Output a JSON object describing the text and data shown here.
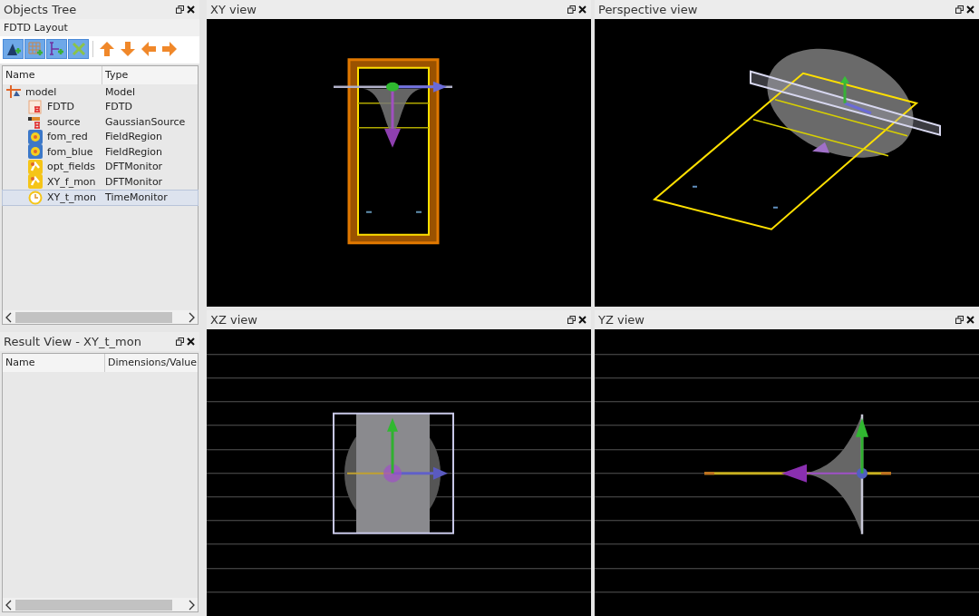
{
  "objects_tree": {
    "title": "Objects Tree",
    "layout_label": "FDTD Layout",
    "columns": [
      "Name",
      "Type"
    ],
    "rows": [
      {
        "name": "model",
        "type": "Model",
        "kind": "model",
        "selected": false,
        "children": [
          {
            "name": "FDTD",
            "type": "FDTD",
            "kind": "fdtd",
            "selected": false
          },
          {
            "name": "source",
            "type": "GaussianSource",
            "kind": "source",
            "selected": false
          },
          {
            "name": "fom_red",
            "type": "FieldRegion",
            "kind": "field_region",
            "selected": false
          },
          {
            "name": "fom_blue",
            "type": "FieldRegion",
            "kind": "field_region",
            "selected": false
          },
          {
            "name": "opt_fields",
            "type": "DFTMonitor",
            "kind": "dft_monitor",
            "selected": false
          },
          {
            "name": "XY_f_mon",
            "type": "DFTMonitor",
            "kind": "dft_monitor",
            "selected": false
          },
          {
            "name": "XY_t_mon",
            "type": "TimeMonitor",
            "kind": "time_monitor",
            "selected": true
          }
        ]
      }
    ]
  },
  "result_view": {
    "title": "Result View - XY_t_mon",
    "columns": [
      "Name",
      "Dimensions/Value"
    ]
  },
  "views": [
    {
      "title": "XY view",
      "kind": "xy"
    },
    {
      "title": "Perspective view",
      "kind": "perspective"
    },
    {
      "title": "XZ view",
      "kind": "xz"
    },
    {
      "title": "YZ view",
      "kind": "yz"
    }
  ]
}
